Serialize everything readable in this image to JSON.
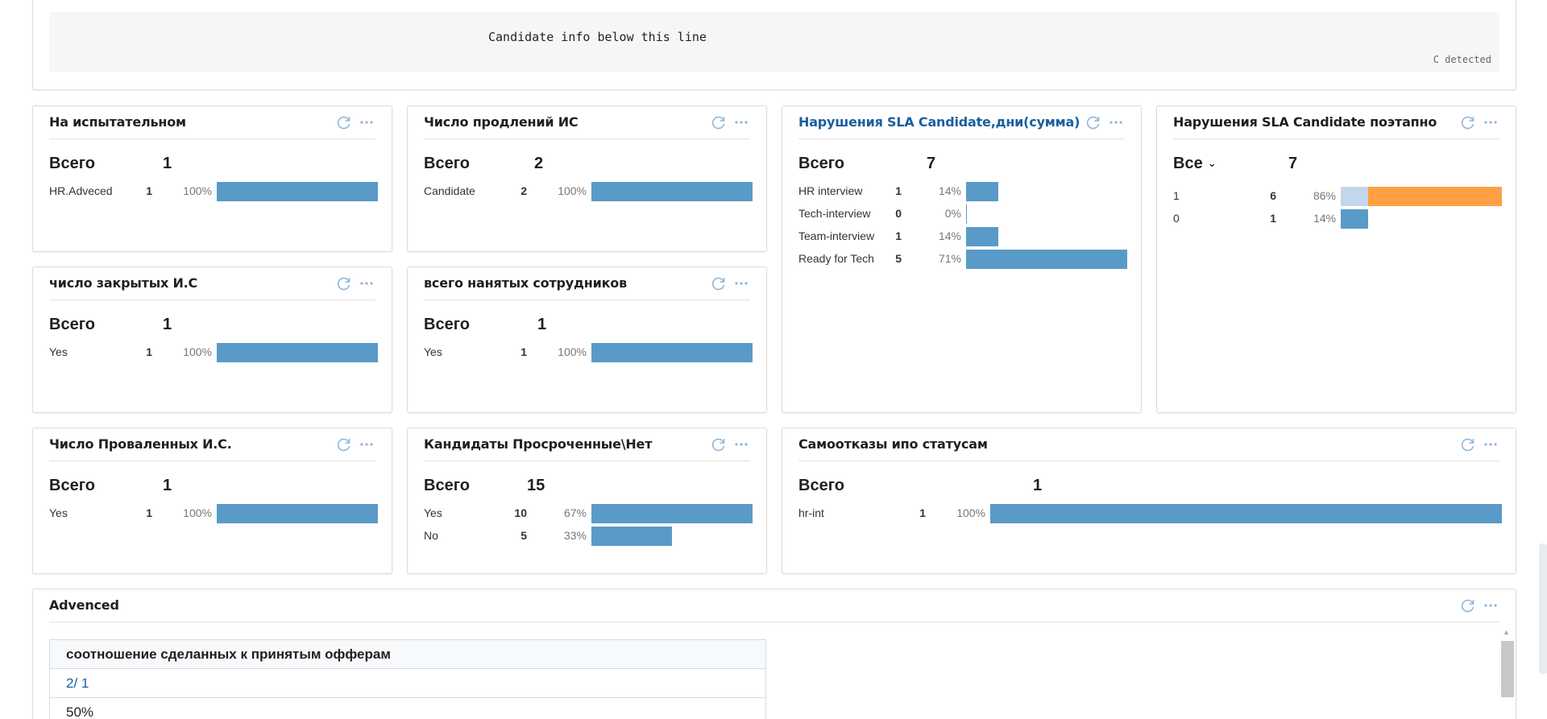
{
  "top_widget": {
    "text": "Candidate info below this line",
    "detected_label": "C detected"
  },
  "icons": {
    "refresh": "refresh-icon",
    "more": "more-dots-icon",
    "accent": "#5a9ac8",
    "orange": "#ff9f43",
    "light": "#c3d6ec",
    "link": "#1a5f9e"
  },
  "panels": {
    "p1": {
      "title": "На испытательном",
      "total_label": "Всего",
      "total": "1",
      "rows": [
        {
          "label": "HR.Adveced",
          "count": "1",
          "pct": "100%",
          "fraction": 1.0
        }
      ]
    },
    "p2": {
      "title": "Число продлений ИС",
      "total_label": "Всего",
      "total": "2",
      "rows": [
        {
          "label": "Candidate",
          "count": "2",
          "pct": "100%",
          "fraction": 1.0
        }
      ]
    },
    "p3": {
      "title": "Нарушения SLA Candidate,дни(сумма)",
      "total_label": "Всего",
      "total": "7",
      "rows": [
        {
          "label": "HR interview",
          "count": "1",
          "pct": "14%",
          "fraction": 0.2
        },
        {
          "label": "Tech-interview",
          "count": "0",
          "pct": "0%",
          "fraction": 0
        },
        {
          "label": "Team-interview",
          "count": "1",
          "pct": "14%",
          "fraction": 0.2
        },
        {
          "label": "Ready for Tech",
          "count": "5",
          "pct": "71%",
          "fraction": 1.0
        }
      ]
    },
    "p4": {
      "title": "Нарушения SLA Candidate поэтапно",
      "total_label": "Все",
      "total": "7",
      "rows": [
        {
          "label": "1",
          "count": "6",
          "pct": "86%",
          "fraction_light": 0.17,
          "fraction_orange": 0.83
        },
        {
          "label": "0",
          "count": "1",
          "pct": "14%",
          "fraction": 0.17
        }
      ]
    },
    "p5": {
      "title": "число закрытых И.С",
      "total_label": "Всего",
      "total": "1",
      "rows": [
        {
          "label": "Yes",
          "count": "1",
          "pct": "100%",
          "fraction": 1.0
        }
      ]
    },
    "p6": {
      "title": "всего нанятых сотрудников",
      "total_label": "Всего",
      "total": "1",
      "rows": [
        {
          "label": "Yes",
          "count": "1",
          "pct": "100%",
          "fraction": 1.0
        }
      ]
    },
    "p7": {
      "title": "Число Проваленных И.С.",
      "total_label": "Всего",
      "total": "1",
      "rows": [
        {
          "label": "Yes",
          "count": "1",
          "pct": "100%",
          "fraction": 1.0
        }
      ]
    },
    "p8": {
      "title": "Кандидаты Просроченные\\Нет",
      "total_label": "Всего",
      "total": "15",
      "rows": [
        {
          "label": "Yes",
          "count": "10",
          "pct": "67%",
          "fraction": 1.0
        },
        {
          "label": "No",
          "count": "5",
          "pct": "33%",
          "fraction": 0.5
        }
      ]
    },
    "p9": {
      "title": "Самоотказы ипо статусам",
      "total_label": "Всего",
      "total": "1",
      "rows": [
        {
          "label": "hr-int",
          "count": "1",
          "pct": "100%",
          "fraction": 1.0
        }
      ]
    },
    "p10": {
      "title": "Advenced",
      "table": {
        "header": "соотношение сделанных к принятым офферам",
        "row1": "2/ 1",
        "row2": "50%"
      }
    }
  }
}
